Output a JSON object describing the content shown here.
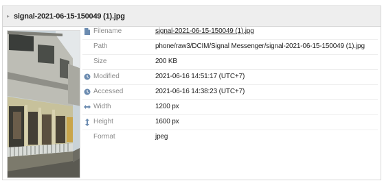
{
  "header": {
    "title": "signal-2021-06-15-150049 (1).jpg",
    "collapse_icon": "triangle-right-icon"
  },
  "thumbnail": {
    "alt": "Photo of a two-storey building with balconies and a railing"
  },
  "properties": [
    {
      "name": "filename",
      "icon": "file-icon",
      "label": "Filename",
      "value": "signal-2021-06-15-150049 (1).jpg",
      "is_link": true
    },
    {
      "name": "path",
      "icon": "",
      "label": "Path",
      "value": "phone/raw3/DCIM/Signal Messenger/signal-2021-06-15-150049 (1).jpg",
      "is_link": false
    },
    {
      "name": "size",
      "icon": "",
      "label": "Size",
      "value": "200 KB",
      "is_link": false
    },
    {
      "name": "modified",
      "icon": "clock-icon",
      "label": "Modified",
      "value": "2021-06-16 14:51:17 (UTC+7)",
      "is_link": false
    },
    {
      "name": "accessed",
      "icon": "clock-icon",
      "label": "Accessed",
      "value": "2021-06-16 14:38:23 (UTC+7)",
      "is_link": false
    },
    {
      "name": "width",
      "icon": "horizontal-arrows-icon",
      "label": "Width",
      "value": "1200 px",
      "is_link": false
    },
    {
      "name": "height",
      "icon": "vertical-arrows-icon",
      "label": "Height",
      "value": "1600 px",
      "is_link": false
    },
    {
      "name": "format",
      "icon": "",
      "label": "Format",
      "value": "jpeg",
      "is_link": false
    }
  ],
  "colors": {
    "header_bg": "#eeeeee",
    "icon_blue": "#6b8bb0",
    "label_gray": "#8a8a8a",
    "value_text": "#222222"
  }
}
